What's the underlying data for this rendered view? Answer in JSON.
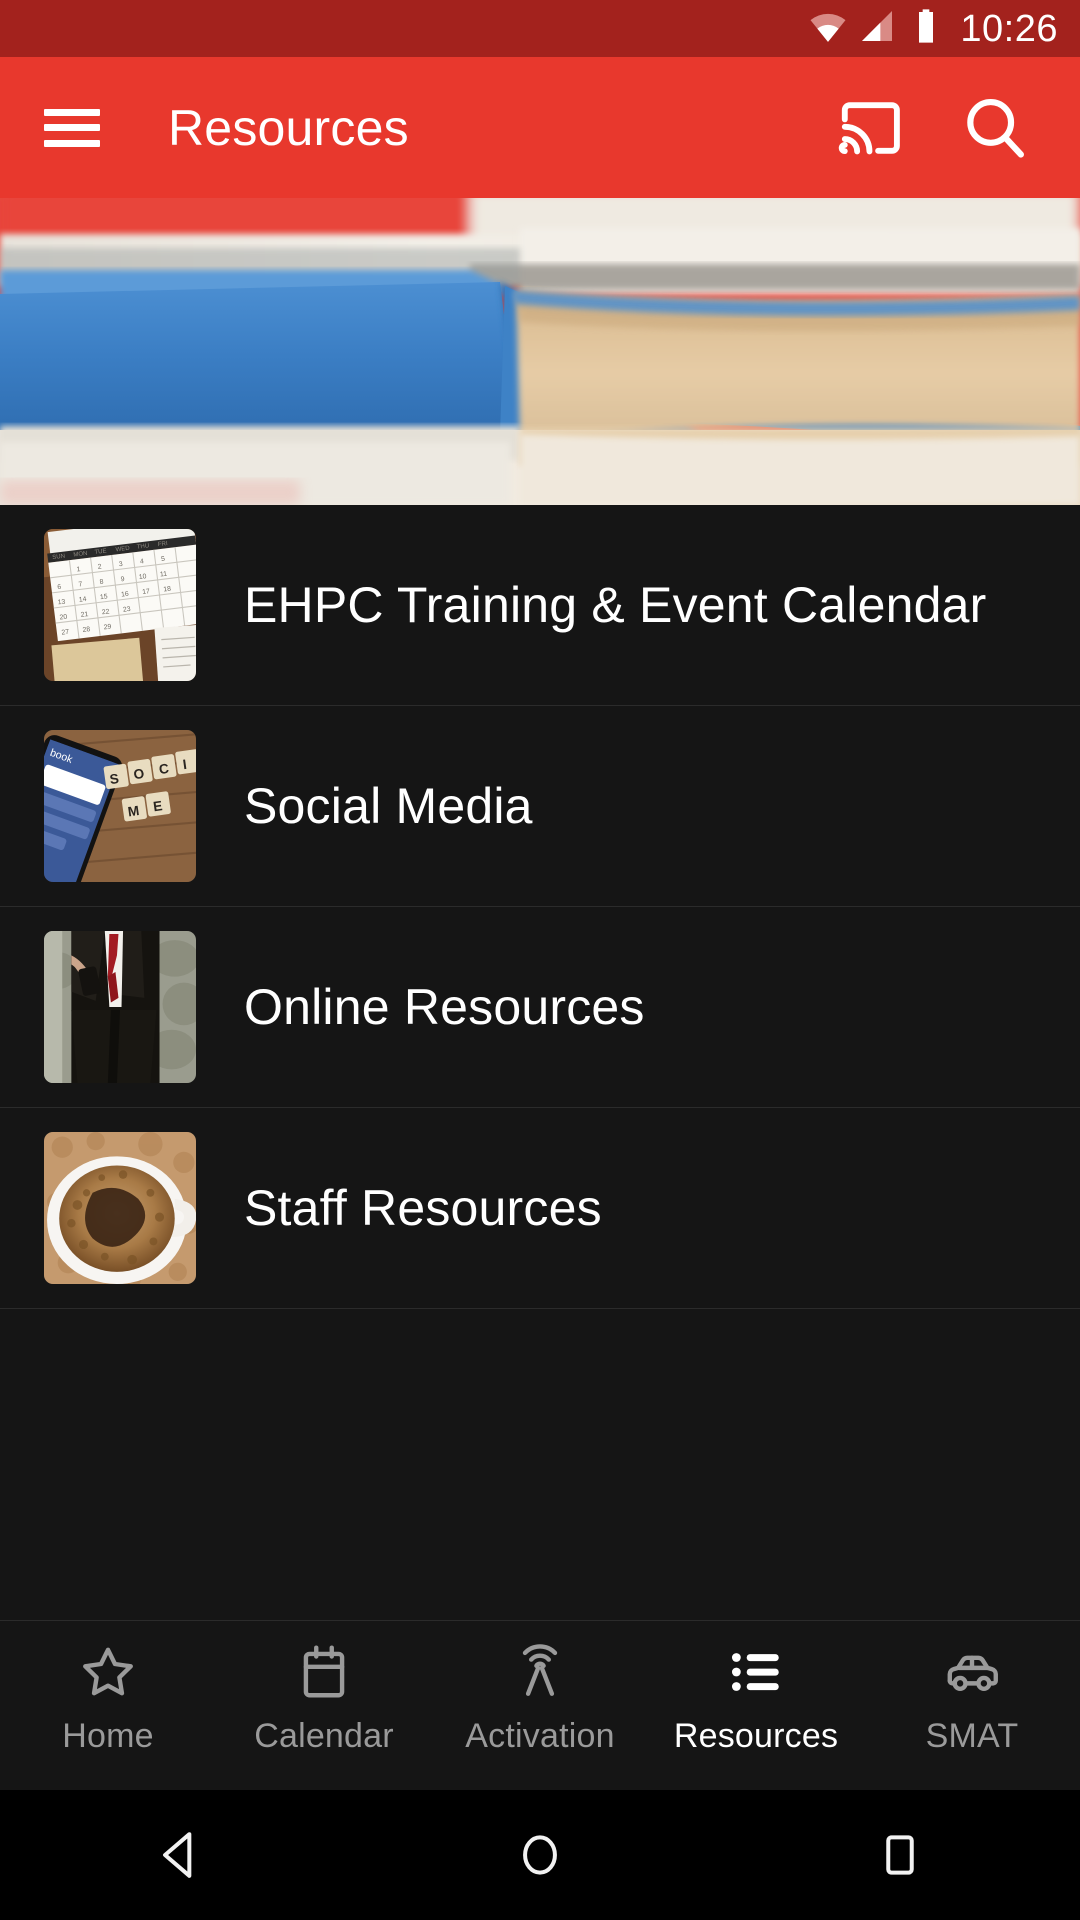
{
  "status_bar": {
    "time": "10:26",
    "icons": [
      "wifi-icon",
      "cellular-signal-icon",
      "battery-icon"
    ],
    "background_color": "#A3221D"
  },
  "app_bar": {
    "title": "Resources",
    "menu_icon": "hamburger-menu-icon",
    "cast_icon": "cast-icon",
    "search_icon": "search-icon",
    "background_color": "#E8382D",
    "text_color": "#FFFFFF"
  },
  "hero": {
    "alt": "stacked-books-photo",
    "colors": {
      "book_cover": "#3D7FC4",
      "pages": "#E3CBA8",
      "backdrop": "#E8453B"
    }
  },
  "list": {
    "background_color": "#151515",
    "items": [
      {
        "title": "EHPC Training & Event Calendar",
        "thumb": "calendar-clipboard-thumbnail"
      },
      {
        "title": "Social Media",
        "thumb": "phone-scrabble-tiles-thumbnail"
      },
      {
        "title": "Online Resources",
        "thumb": "man-in-suit-with-phone-thumbnail"
      },
      {
        "title": "Staff Resources",
        "thumb": "coffee-cup-thumbnail"
      }
    ]
  },
  "bottom_nav": {
    "active_index": 3,
    "active_color": "#FFFFFF",
    "inactive_color": "#9A9A9A",
    "items": [
      {
        "label": "Home",
        "icon": "star-icon"
      },
      {
        "label": "Calendar",
        "icon": "calendar-icon"
      },
      {
        "label": "Activation",
        "icon": "broadcast-tower-icon"
      },
      {
        "label": "Resources",
        "icon": "list-icon"
      },
      {
        "label": "SMAT",
        "icon": "car-icon"
      }
    ]
  },
  "system_nav": {
    "back": "back-triangle-icon",
    "home": "home-circle-icon",
    "recents": "recents-square-icon"
  }
}
